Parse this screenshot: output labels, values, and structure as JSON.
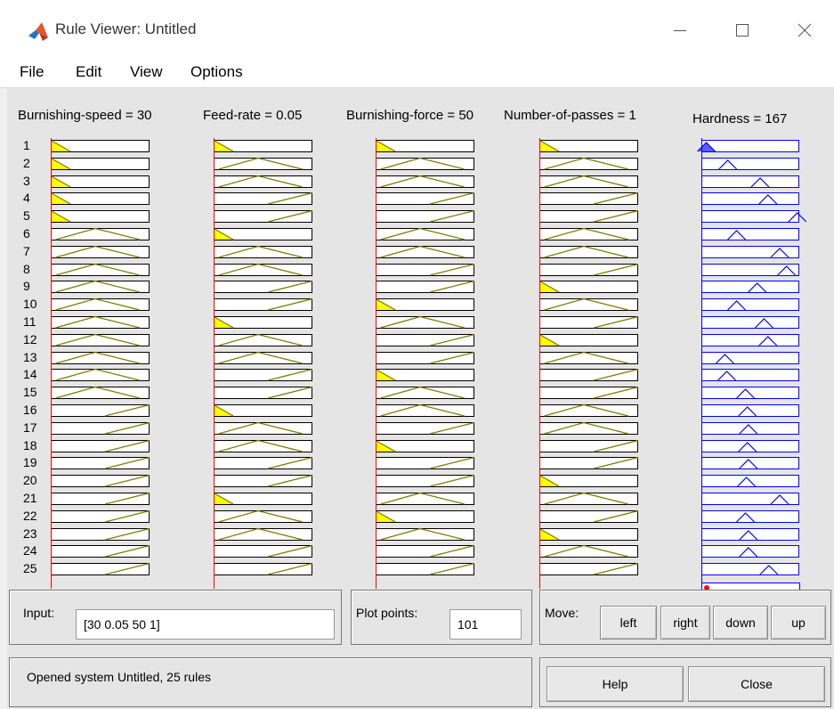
{
  "window": {
    "title": "Rule Viewer: Untitled",
    "controls": [
      "minimize-icon",
      "maximize-icon",
      "close-icon"
    ]
  },
  "menu": [
    "File",
    "Edit",
    "View",
    "Options"
  ],
  "variables": {
    "inputs": [
      "Burnishing-speed = 30",
      "Feed-rate = 0.05",
      "Burnishing-force = 50",
      "Number-of-passes = 1"
    ],
    "output": "Hardness = 167"
  },
  "rules": {
    "count": 25,
    "labels": [
      "1",
      "2",
      "3",
      "4",
      "5",
      "6",
      "7",
      "8",
      "9",
      "10",
      "11",
      "12",
      "13",
      "14",
      "15",
      "16",
      "17",
      "18",
      "19",
      "20",
      "21",
      "22",
      "23",
      "24",
      "25"
    ],
    "input_mf": [
      [
        "L",
        "L",
        "L",
        "L",
        "L",
        "M",
        "M",
        "M",
        "M",
        "M",
        "M",
        "M",
        "M",
        "M",
        "M",
        "H",
        "H",
        "H",
        "H",
        "H",
        "H",
        "H",
        "H",
        "H",
        "H"
      ],
      [
        "L",
        "M",
        "M",
        "H",
        "H",
        "L",
        "M",
        "M",
        "H",
        "H",
        "L",
        "M",
        "M",
        "H",
        "H",
        "L",
        "M",
        "M",
        "H",
        "H",
        "L",
        "M",
        "M",
        "H",
        "H"
      ],
      [
        "L",
        "M",
        "M",
        "H",
        "H",
        "M",
        "M",
        "H",
        "H",
        "L",
        "M",
        "H",
        "H",
        "L",
        "M",
        "M",
        "H",
        "L",
        "H",
        "H",
        "M",
        "L",
        "M",
        "H",
        "H"
      ],
      [
        "L",
        "M",
        "M",
        "H",
        "H",
        "M",
        "M",
        "H",
        "L",
        "M",
        "H",
        "L",
        "M",
        "H",
        "H",
        "M",
        "M",
        "H",
        "H",
        "L",
        "M",
        "H",
        "L",
        "M",
        "H"
      ]
    ],
    "output_center": [
      0.05,
      0.27,
      0.6,
      0.68,
      0.98,
      0.36,
      0.8,
      0.87,
      0.57,
      0.36,
      0.64,
      0.68,
      0.24,
      0.26,
      0.45,
      0.47,
      0.48,
      0.47,
      0.48,
      0.46,
      0.8,
      0.45,
      0.48,
      0.48,
      0.69
    ]
  },
  "controls": {
    "input_label": "Input:",
    "input_value": "[30 0.05 50 1]",
    "plot_points_label": "Plot points:",
    "plot_points_value": "101",
    "move_label": "Move:",
    "move_buttons": [
      "left",
      "right",
      "down",
      "up"
    ],
    "help_label": "Help",
    "close_label": "Close"
  },
  "status": "Opened system Untitled, 25 rules",
  "colors": {
    "mf_line": "#7a7a00",
    "mf_fill": "#ffff00",
    "output_line": "#0000ff",
    "output_fill": "#5a5aff",
    "marker_red": "#ff0000"
  }
}
